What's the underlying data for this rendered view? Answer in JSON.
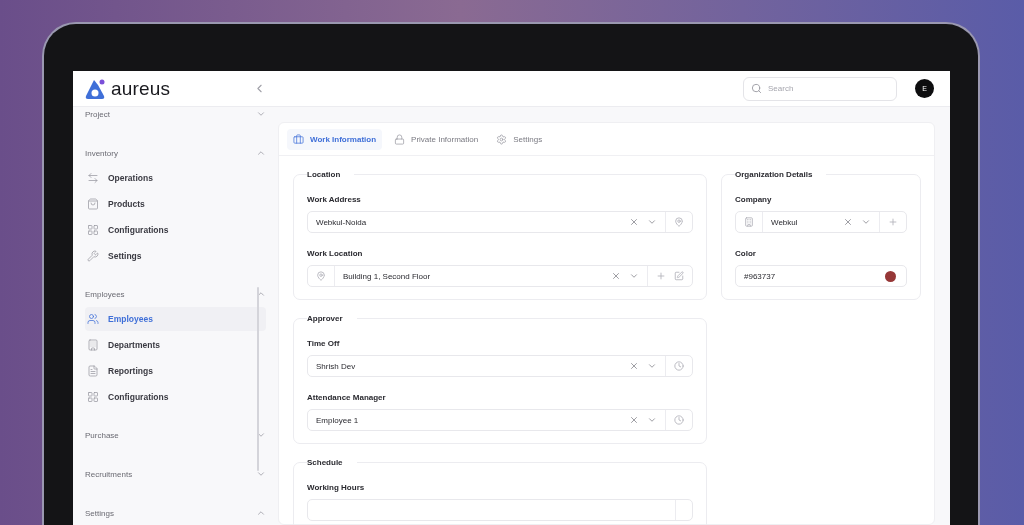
{
  "brand": {
    "name": "aureus"
  },
  "search": {
    "placeholder": "Search"
  },
  "user": {
    "initial": "E"
  },
  "sidebar": {
    "groups": [
      {
        "label": "Project",
        "expanded": false
      },
      {
        "label": "Inventory",
        "expanded": true,
        "items": [
          {
            "label": "Operations",
            "kind": "operations",
            "selected": false
          },
          {
            "label": "Products",
            "kind": "products",
            "selected": false
          },
          {
            "label": "Configurations",
            "kind": "configurations",
            "selected": false
          },
          {
            "label": "Settings",
            "kind": "settings",
            "selected": false
          }
        ]
      },
      {
        "label": "Employees",
        "expanded": true,
        "items": [
          {
            "label": "Employees",
            "kind": "employees",
            "selected": true
          },
          {
            "label": "Departments",
            "kind": "departments",
            "selected": false
          },
          {
            "label": "Reportings",
            "kind": "reportings",
            "selected": false
          },
          {
            "label": "Configurations",
            "kind": "configurations",
            "selected": false
          }
        ]
      },
      {
        "label": "Purchase",
        "expanded": false
      },
      {
        "label": "Recruitments",
        "expanded": false
      },
      {
        "label": "Settings",
        "expanded": true
      }
    ]
  },
  "tabs": [
    {
      "label": "Work Information",
      "kind": "work",
      "selected": true
    },
    {
      "label": "Private Information",
      "kind": "private",
      "selected": false
    },
    {
      "label": "Settings",
      "kind": "settings",
      "selected": false
    }
  ],
  "left_column": [
    {
      "legend": "Location",
      "fields": [
        {
          "label": "Work Address",
          "kind": "address",
          "value": "Webkul-Noida"
        },
        {
          "label": "Work Location",
          "kind": "location",
          "value": "Building 1, Second Floor"
        }
      ]
    },
    {
      "legend": "Approver",
      "fields": [
        {
          "label": "Time Off",
          "kind": "approver",
          "value": "Shrish Dev"
        },
        {
          "label": "Attendance Manager",
          "kind": "approver",
          "value": "Employee 1"
        }
      ]
    },
    {
      "legend": "Schedule",
      "fields": [
        {
          "label": "Working Hours",
          "kind": "schedule"
        }
      ]
    }
  ],
  "right_column": [
    {
      "legend": "Organization Details",
      "fields": [
        {
          "label": "Company",
          "kind": "company",
          "value": "Webkul"
        },
        {
          "label": "Color",
          "kind": "color",
          "value": "#963737"
        }
      ]
    }
  ]
}
